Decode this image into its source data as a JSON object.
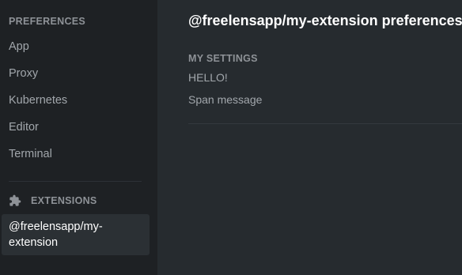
{
  "sidebar": {
    "section_title": "PREFERENCES",
    "items": [
      {
        "label": "App"
      },
      {
        "label": "Proxy"
      },
      {
        "label": "Kubernetes"
      },
      {
        "label": "Editor"
      },
      {
        "label": "Terminal"
      }
    ],
    "extensions": {
      "icon": "puzzle-icon",
      "label": "EXTENSIONS",
      "items": [
        {
          "label": "@freelensapp/my-extension",
          "selected": true
        }
      ]
    }
  },
  "main": {
    "title": "@freelensapp/my-extension preferences",
    "settings_title": "MY SETTINGS",
    "lines": [
      "HELLO!",
      "Span message"
    ]
  },
  "colors": {
    "sidebar_bg": "#1e2124",
    "main_bg": "#262b2f",
    "selected_bg": "#2b3034",
    "muted_text": "#8e9297",
    "nav_text": "#a2a7ac",
    "title_text": "#ffffff"
  }
}
